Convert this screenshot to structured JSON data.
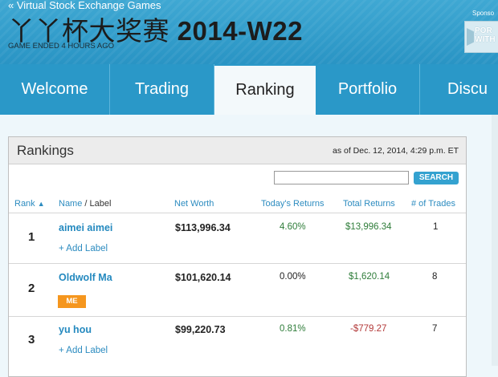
{
  "header": {
    "back_link": "« Virtual Stock Exchange Games",
    "game_name_cn": "丫丫杯大奖赛",
    "game_name_suffix": "2014-W22",
    "status": "GAME ENDED 4 HOURS AGO",
    "sponsor_label": "Sponso",
    "sponsor_text_1": "POR",
    "sponsor_text_2": "WITH"
  },
  "tabs": [
    {
      "label": "Welcome",
      "active": false
    },
    {
      "label": "Trading",
      "active": false
    },
    {
      "label": "Ranking",
      "active": true
    },
    {
      "label": "Portfolio",
      "active": false
    },
    {
      "label": "Discu",
      "active": false
    }
  ],
  "rankings": {
    "title": "Rankings",
    "as_of": "as of Dec. 12, 2014, 4:29 p.m. ET",
    "search_button": "SEARCH",
    "search_value": "",
    "columns": {
      "rank": "Rank",
      "name": "Name",
      "slash": " / ",
      "label": "Label",
      "net_worth": "Net Worth",
      "today": "Today's Returns",
      "total": "Total Returns",
      "trades": "# of Trades"
    },
    "sort_arrow": "▲",
    "add_label": "+ Add Label",
    "me_badge": "ME",
    "rows": [
      {
        "rank": "1",
        "name": "aimei aimei",
        "net_worth": "$113,996.34",
        "today": "4.60%",
        "total": "$13,996.34",
        "trades": "1"
      },
      {
        "rank": "2",
        "name": "Oldwolf Ma",
        "net_worth": "$101,620.14",
        "today": "0.00%",
        "total": "$1,620.14",
        "trades": "8"
      },
      {
        "rank": "3",
        "name": "yu hou",
        "net_worth": "$99,220.73",
        "today": "0.81%",
        "total": "-$779.27",
        "trades": "7"
      }
    ]
  },
  "colors": {
    "header_blue": "#2994c4",
    "link_blue": "#2489bf",
    "positive_green": "#2f7d3a",
    "negative_red": "#b33939",
    "me_orange": "#f5961e"
  }
}
